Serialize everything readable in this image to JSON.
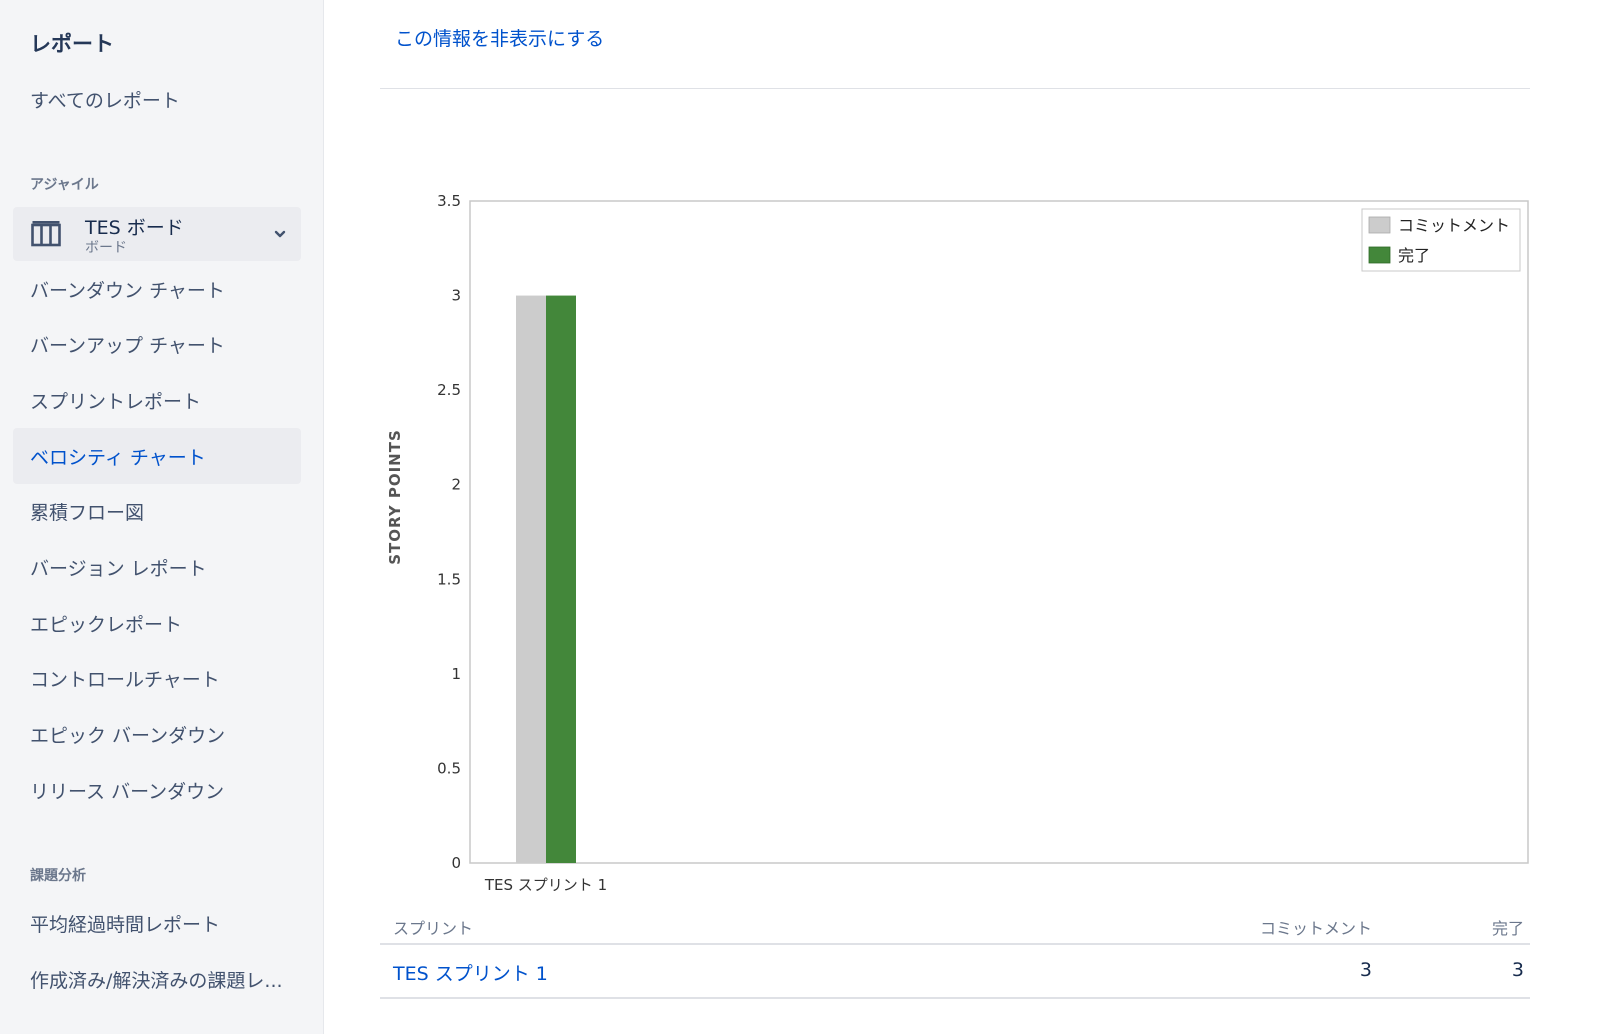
{
  "sidebar": {
    "title": "レポート",
    "all_reports": "すべてのレポート",
    "agile_section": "アジャイル",
    "board": {
      "name": "TES ボード",
      "type": "ボード"
    },
    "items": [
      {
        "label": "バーンダウン チャート"
      },
      {
        "label": "バーンアップ チャート"
      },
      {
        "label": "スプリントレポート"
      },
      {
        "label": "ベロシティ チャート",
        "active": true
      },
      {
        "label": "累積フロー図"
      },
      {
        "label": "バージョン レポート"
      },
      {
        "label": "エピックレポート"
      },
      {
        "label": "コントロールチャート"
      },
      {
        "label": "エピック バーンダウン"
      },
      {
        "label": "リリース バーンダウン"
      }
    ],
    "issue_section": "課題分析",
    "issue_items": [
      {
        "label": "平均経過時間レポート"
      },
      {
        "label": "作成済み/解決済みの課題レ..."
      }
    ]
  },
  "main": {
    "hide_info_link": "この情報を非表示にする"
  },
  "chart_data": {
    "type": "bar",
    "categories": [
      "TES スプリント 1"
    ],
    "series": [
      {
        "name": "コミットメント",
        "values": [
          3
        ],
        "color": "#cccccc"
      },
      {
        "name": "完了",
        "values": [
          3
        ],
        "color": "#43873a"
      }
    ],
    "ylabel": "STORY POINTS",
    "xlabel": "",
    "ylim": [
      0,
      3.5
    ],
    "yticks": [
      0,
      0.5,
      1,
      1.5,
      2,
      2.5,
      3,
      3.5
    ],
    "ytick_labels": [
      "0",
      "0.5",
      "1",
      "1.5",
      "2",
      "2.5",
      "3",
      "3.5"
    ],
    "legend_placement": "top-right",
    "grid": false
  },
  "table": {
    "headers": {
      "sprint": "スプリント",
      "commitment": "コミットメント",
      "done": "完了"
    },
    "rows": [
      {
        "sprint": "TES スプリント 1",
        "commitment": "3",
        "done": "3"
      }
    ]
  }
}
